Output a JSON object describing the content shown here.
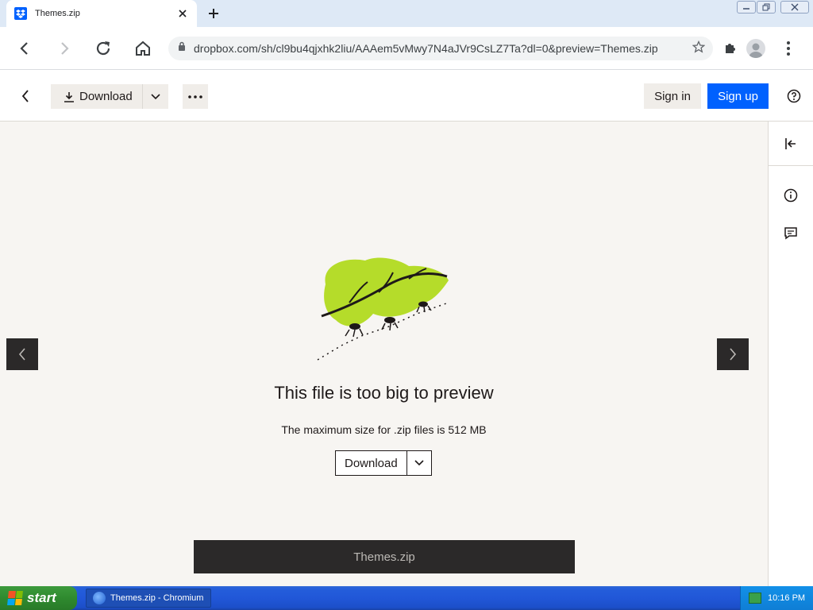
{
  "browser": {
    "tab_title": "Themes.zip",
    "url": "dropbox.com/sh/cl9bu4qjxhk2liu/AAAem5vMwy7N4aJVr9CsLZ7Ta?dl=0&preview=Themes.zip"
  },
  "header": {
    "download_label": "Download",
    "signin_label": "Sign in",
    "signup_label": "Sign up"
  },
  "preview": {
    "title": "This file is too big to preview",
    "subtitle": "The maximum size for .zip files is 512 MB",
    "download_label": "Download",
    "filename": "Themes.zip"
  },
  "taskbar": {
    "start_label": "start",
    "task_label": "Themes.zip - Chromium",
    "clock": "10:16 PM"
  },
  "colors": {
    "accent": "#0061fe",
    "page_bg": "#f7f5f2",
    "leaf": "#b5dc2a",
    "dark_bar": "#2b2929"
  },
  "icons": [
    "dropbox-favicon",
    "close-icon",
    "plus-icon",
    "back-icon",
    "forward-icon",
    "reload-icon",
    "home-icon",
    "lock-icon",
    "star-icon",
    "puzzle-icon",
    "profile-icon",
    "kebab-icon",
    "download-icon",
    "chevron-down-icon",
    "more-icon",
    "help-icon",
    "collapse-panel-icon",
    "info-icon",
    "comment-icon",
    "chevron-left-icon",
    "chevron-right-icon"
  ]
}
